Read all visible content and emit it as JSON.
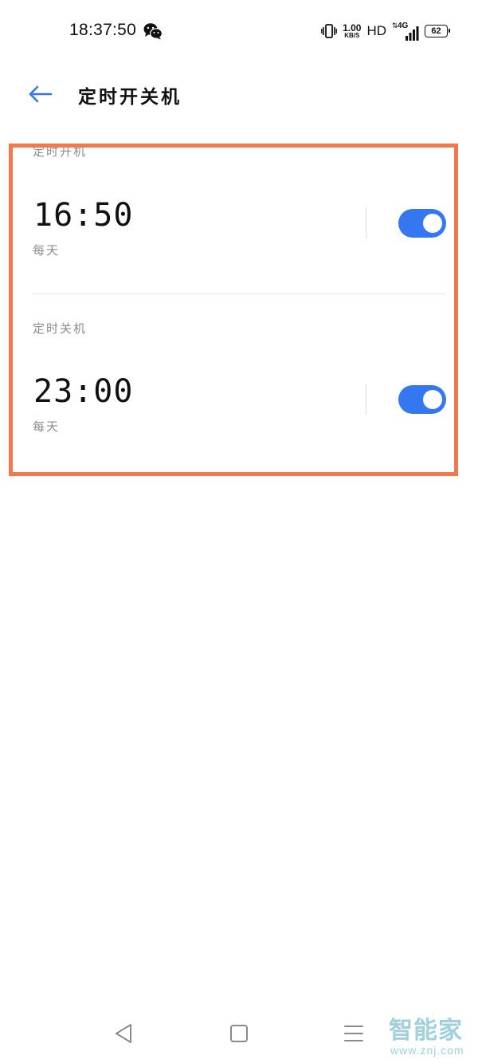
{
  "status_bar": {
    "time": "18:37:50",
    "net_speed_value": "1.00",
    "net_speed_unit": "KB/S",
    "hd_label": "HD",
    "network_type": "4G",
    "battery_level": "62",
    "icons": [
      "wechat-icon",
      "vibrate-icon",
      "signal-icon",
      "battery-icon"
    ]
  },
  "header": {
    "title": "定时开关机",
    "back_icon": "back-arrow-icon"
  },
  "schedules": [
    {
      "label": "定时开机",
      "time": "16:50",
      "repeat": "每天",
      "enabled": true
    },
    {
      "label": "定时关机",
      "time": "23:00",
      "repeat": "每天",
      "enabled": true
    }
  ],
  "nav_bar": {
    "icons": [
      "nav-back-icon",
      "nav-home-icon",
      "nav-menu-icon"
    ]
  },
  "watermark": {
    "brand": "智能家",
    "url": "www.znj.com"
  },
  "colors": {
    "accent": "#3577f1",
    "highlight_border": "#f3774c",
    "secondary_text": "#8c8c8c",
    "watermark": "#9fd0dc"
  }
}
